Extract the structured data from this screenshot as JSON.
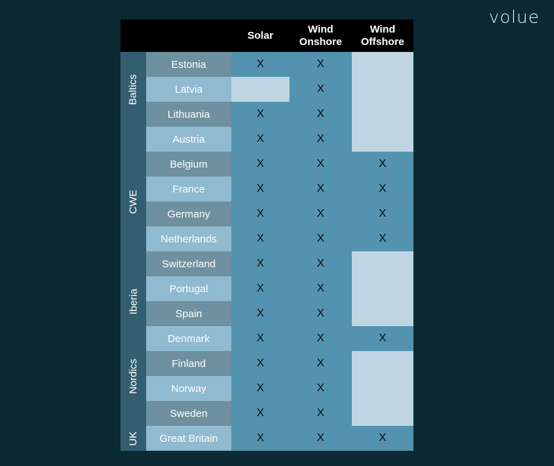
{
  "logo": "volue",
  "header": {
    "columns": [
      "Solar",
      "Wind\nOnshore",
      "Wind\nOffshore"
    ]
  },
  "groups": [
    {
      "label": "Baltics",
      "center_row": 1.5
    },
    {
      "label": "CWE",
      "center_row": 6.0
    },
    {
      "label": "Iberia",
      "center_row": 10.0
    },
    {
      "label": "Nordics",
      "center_row": 13.0
    },
    {
      "label": "UK",
      "center_row": 15.5
    }
  ],
  "rows": [
    {
      "country": "Estonia",
      "solar": "X",
      "onshore": "X",
      "offshore": ""
    },
    {
      "country": "Latvia",
      "solar": "",
      "onshore": "X",
      "offshore": ""
    },
    {
      "country": "Lithuania",
      "solar": "X",
      "onshore": "X",
      "offshore": ""
    },
    {
      "country": "Austria",
      "solar": "X",
      "onshore": "X",
      "offshore": ""
    },
    {
      "country": "Belgium",
      "solar": "X",
      "onshore": "X",
      "offshore": "X"
    },
    {
      "country": "France",
      "solar": "X",
      "onshore": "X",
      "offshore": "X"
    },
    {
      "country": "Germany",
      "solar": "X",
      "onshore": "X",
      "offshore": "X"
    },
    {
      "country": "Netherlands",
      "solar": "X",
      "onshore": "X",
      "offshore": "X"
    },
    {
      "country": "Switzerland",
      "solar": "X",
      "onshore": "X",
      "offshore": ""
    },
    {
      "country": "Portugal",
      "solar": "X",
      "onshore": "X",
      "offshore": ""
    },
    {
      "country": "Spain",
      "solar": "X",
      "onshore": "X",
      "offshore": ""
    },
    {
      "country": "Denmark",
      "solar": "X",
      "onshore": "X",
      "offshore": "X"
    },
    {
      "country": "Finland",
      "solar": "X",
      "onshore": "X",
      "offshore": ""
    },
    {
      "country": "Norway",
      "solar": "X",
      "onshore": "X",
      "offshore": ""
    },
    {
      "country": "Sweden",
      "solar": "X",
      "onshore": "X",
      "offshore": ""
    },
    {
      "country": "Great Britain",
      "solar": "X",
      "onshore": "X",
      "offshore": "X"
    }
  ]
}
